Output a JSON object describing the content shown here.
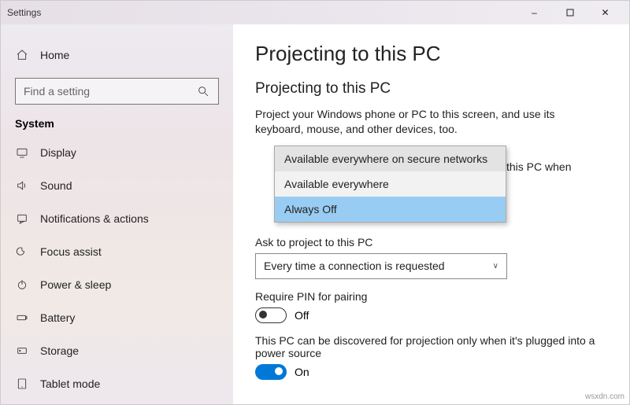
{
  "window": {
    "title": "Settings"
  },
  "sidebar": {
    "home_label": "Home",
    "search_placeholder": "Find a setting",
    "category": "System",
    "items": [
      {
        "label": "Display"
      },
      {
        "label": "Sound"
      },
      {
        "label": "Notifications & actions"
      },
      {
        "label": "Focus assist"
      },
      {
        "label": "Power & sleep"
      },
      {
        "label": "Battery"
      },
      {
        "label": "Storage"
      },
      {
        "label": "Tablet mode"
      }
    ]
  },
  "page": {
    "title": "Projecting to this PC",
    "section_title": "Projecting to this PC",
    "description": "Project your Windows phone or PC to this screen, and use its keyboard, mouse, and other devices, too.",
    "behind_fragment": "this PC when",
    "availability": {
      "options": [
        "Available everywhere on secure networks",
        "Available everywhere",
        "Always Off"
      ],
      "selected_index": 2,
      "hover_index": 0
    },
    "ask_label": "Ask to project to this PC",
    "ask_value": "Every time a connection is requested",
    "pin_label": "Require PIN for pairing",
    "pin_toggle": {
      "on": false,
      "text": "Off"
    },
    "discover_label": "This PC can be discovered for projection only when it's plugged into a power source",
    "discover_toggle": {
      "on": true,
      "text": "On"
    }
  },
  "watermark": "wsxdn.com"
}
